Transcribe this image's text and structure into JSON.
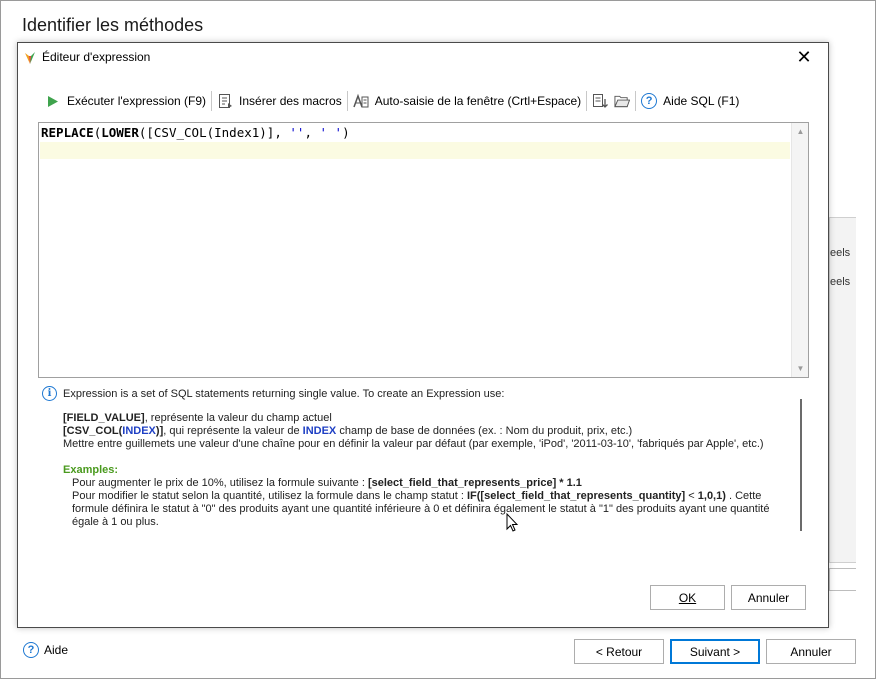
{
  "wizard": {
    "title": "Identifier les méthodes",
    "background_fragments": [
      "eels",
      "eels"
    ],
    "help_label": "Aide",
    "back_label": "< Retour",
    "back_underline": "R",
    "next_label": "Suivant >",
    "next_underline": "S",
    "cancel_label": "Annuler"
  },
  "dialog": {
    "title": "Éditeur d'expression",
    "close_glyph": "✕",
    "toolbar": {
      "execute_label": "Exécuter l'expression (F9)",
      "insert_macros_label": "Insérer des macros",
      "autocomplete_label": "Auto-saisie de la fenêtre (Crtl+Espace)",
      "sql_help_label": "Aide SQL (F1)"
    },
    "editor": {
      "tokens": [
        {
          "text": "REPLACE",
          "style": "kw"
        },
        {
          "text": "(",
          "style": ""
        },
        {
          "text": "LOWER",
          "style": "kw"
        },
        {
          "text": "([CSV_COL(Index1)], ",
          "style": ""
        },
        {
          "text": "''",
          "style": "str"
        },
        {
          "text": ", ",
          "style": ""
        },
        {
          "text": "' '",
          "style": "str"
        },
        {
          "text": ")",
          "style": ""
        }
      ]
    },
    "info": {
      "heading": "Expression is a set of SQL statements returning single value. To create an Expression use:",
      "field_value_token": "[FIELD_VALUE]",
      "field_value_text": ", représente la valeur du champ actuel",
      "csv_col_prefix": "[CSV_COL(",
      "csv_col_index": "INDEX",
      "csv_col_suffix": ")]",
      "csv_col_text_1": ", qui représente la valeur de ",
      "csv_col_index_2": "INDEX",
      "csv_col_text_2": " champ de base de données (ex. : Nom du produit, prix, etc.)",
      "quote_text": "Mettre entre guillemets une valeur d'une chaîne pour en définir la valeur par défaut (par exemple, 'iPod', '2011-03-10', 'fabriqués par Apple', etc.)",
      "examples_label": "Examples:",
      "example1_text": "Pour augmenter le prix de 10%, utilisez la formule suivante : ",
      "example1_formula": "[select_field_that_represents_price] * 1.1",
      "example2_text": "Pour modifier le statut selon la quantité, utilisez la formule dans le champ statut : ",
      "example2_formula_a": "IF([select_field_that_represents_quantity]",
      "example2_formula_lt": " < ",
      "example2_formula_b": "1,0,1)",
      "example2_tail": " . Cette formule définira le statut à \"0\" des produits ayant une quantité inférieure à 0 et définira également le statut à \"1\" des produits ayant une quantité égale à 1 ou plus."
    },
    "ok_label": "OK",
    "ok_underline": "O",
    "cancel_label": "Annuler"
  },
  "colors": {
    "accent_blue": "#1e78d2",
    "index_blue": "#1e3fc4",
    "examples_green": "#4a9a1e",
    "run_green": "#3fa34d",
    "current_line": "#fbfbe2"
  }
}
